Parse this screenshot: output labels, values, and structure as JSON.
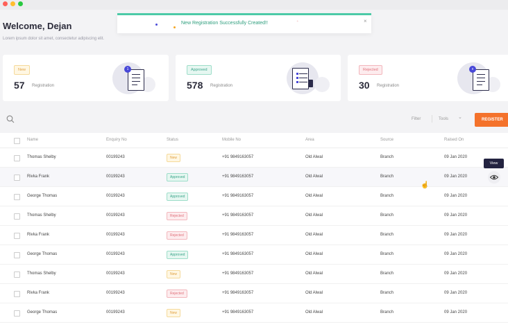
{
  "window": {
    "dots": [
      "#ff5f57",
      "#ffbd2e",
      "#28c840"
    ]
  },
  "toast": {
    "message": "New Registration Successfully Created!!",
    "close": "×"
  },
  "header": {
    "welcome": "Welcome, Dejan",
    "subtitle": "Lorem ipsum dolor sit amet, consectetur adipiscing elit."
  },
  "cards": [
    {
      "badge": "New",
      "count": "57",
      "label": "Registration",
      "icon_badge": "1"
    },
    {
      "badge": "Approved",
      "count": "578",
      "label": "Registration",
      "icon_badge": ""
    },
    {
      "badge": "Rejected",
      "count": "30",
      "label": "Registration",
      "icon_badge": "x"
    }
  ],
  "toolbar": {
    "filter": "Filter",
    "tools": "Tools",
    "register": "REGISTER"
  },
  "table": {
    "columns": [
      "Name",
      "Enquiry No",
      "Status",
      "Mobile No",
      "Area",
      "Source",
      "Raised On"
    ],
    "rows": [
      {
        "name": "Thomas Shelby",
        "enquiry": "00199243",
        "status": "New",
        "mobile": "+91 9849163057",
        "area": "Old Alwal",
        "source": "Branch",
        "raised": "09 Jan 2020"
      },
      {
        "name": "Rivka Frank",
        "enquiry": "00199243",
        "status": "Approved",
        "mobile": "+91 9849163057",
        "area": "Old Alwal",
        "source": "Branch",
        "raised": "09 Jan 2020"
      },
      {
        "name": "George Thomas",
        "enquiry": "00199243",
        "status": "Approved",
        "mobile": "+91 9849163057",
        "area": "Old Alwal",
        "source": "Branch",
        "raised": "09 Jan 2020"
      },
      {
        "name": "Thomas Shelby",
        "enquiry": "00199243",
        "status": "Rejected",
        "mobile": "+91 9849163057",
        "area": "Old Alwal",
        "source": "Branch",
        "raised": "09 Jan 2020"
      },
      {
        "name": "Rivka Frank",
        "enquiry": "00199243",
        "status": "Rejected",
        "mobile": "+91 9849163057",
        "area": "Old Alwal",
        "source": "Branch",
        "raised": "09 Jan 2020"
      },
      {
        "name": "George Thomas",
        "enquiry": "00199243",
        "status": "Approved",
        "mobile": "+91 9849163057",
        "area": "Old Alwal",
        "source": "Branch",
        "raised": "09 Jan 2020"
      },
      {
        "name": "Thomas Shelby",
        "enquiry": "00199243",
        "status": "New",
        "mobile": "+91 9849163057",
        "area": "Old Alwal",
        "source": "Branch",
        "raised": "09 Jan 2020"
      },
      {
        "name": "Rivka Frank",
        "enquiry": "00199243",
        "status": "Rejected",
        "mobile": "+91 9849163057",
        "area": "Old Alwal",
        "source": "Branch",
        "raised": "09 Jan 2020"
      },
      {
        "name": "George Thomas",
        "enquiry": "00199243",
        "status": "New",
        "mobile": "+91 9849163057",
        "area": "Old Alwal",
        "source": "Branch",
        "raised": "09 Jan 2020"
      }
    ]
  },
  "row_action": {
    "tooltip": "View",
    "icon": "eye-icon"
  },
  "colors": {
    "accent": "#f4722b",
    "toast": "#4ccaa7",
    "new": "#e0a040",
    "approved": "#3aa58a",
    "rejected": "#e0707a"
  }
}
